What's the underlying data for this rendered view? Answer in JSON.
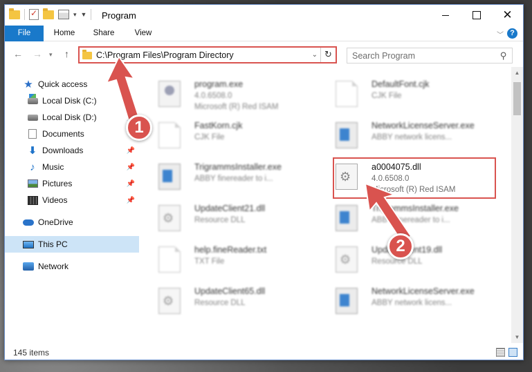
{
  "window": {
    "title": "Program"
  },
  "ribbon": {
    "tabs": [
      "File",
      "Home",
      "Share",
      "View"
    ]
  },
  "nav": {
    "address": "C:\\Program Files\\Program Directory",
    "search_placeholder": "Search Program"
  },
  "sidebar": {
    "items": [
      {
        "label": "Quick access",
        "icon": "star-icon",
        "pinned": false
      },
      {
        "label": "Local Disk (C:)",
        "icon": "drive-icon",
        "pinned": false
      },
      {
        "label": "Local Disk (D:)",
        "icon": "drive-icon",
        "pinned": true
      },
      {
        "label": "Documents",
        "icon": "document-icon",
        "pinned": false
      },
      {
        "label": "Downloads",
        "icon": "download-icon",
        "pinned": true
      },
      {
        "label": "Music",
        "icon": "music-icon",
        "pinned": true
      },
      {
        "label": "Pictures",
        "icon": "pictures-icon",
        "pinned": true
      },
      {
        "label": "Videos",
        "icon": "videos-icon",
        "pinned": true
      },
      {
        "label": "OneDrive",
        "icon": "cloud-icon",
        "pinned": false
      },
      {
        "label": "This PC",
        "icon": "computer-icon",
        "pinned": false,
        "selected": true
      },
      {
        "label": "Network",
        "icon": "network-icon",
        "pinned": false
      }
    ]
  },
  "files": [
    {
      "name": "program.exe",
      "line1": "4.0.6508.0",
      "line2": "Microsoft (R) Red ISAM",
      "icon": "exe-icon"
    },
    {
      "name": "DefaultFont.cjk",
      "line1": "CJK File",
      "line2": "",
      "icon": "file-icon"
    },
    {
      "name": "FastKorn.cjk",
      "line1": "CJK File",
      "line2": "",
      "icon": "file-icon"
    },
    {
      "name": "NetworkLicenseServer.exe",
      "line1": "ABBY network licens...",
      "line2": "",
      "icon": "app-icon"
    },
    {
      "name": "TrigrammsInstaller.exe",
      "line1": "ABBY finereader to i...",
      "line2": "",
      "icon": "app-icon"
    },
    {
      "name": "a0004075.dll",
      "line1": "4.0.6508.0",
      "line2": "Microsoft (R) Red ISAM",
      "icon": "dll-gear-icon"
    },
    {
      "name": "UpdateClient21.dll",
      "line1": "Resource DLL",
      "line2": "",
      "icon": "dll-gear-icon"
    },
    {
      "name": "TrigrammsInstaller.exe",
      "line1": "ABBY finereader to i...",
      "line2": "",
      "icon": "app-icon"
    },
    {
      "name": "help.fineReader.txt",
      "line1": "TXT File",
      "line2": "",
      "icon": "file-icon"
    },
    {
      "name": "UpdateClient19.dll",
      "line1": "Resource DLL",
      "line2": "",
      "icon": "dll-gear-icon"
    },
    {
      "name": "UpdateClient65.dll",
      "line1": "Resource DLL",
      "line2": "",
      "icon": "dll-gear-icon"
    },
    {
      "name": "NetworkLicenseServer.exe",
      "line1": "ABBY network licens...",
      "line2": "",
      "icon": "app-icon"
    }
  ],
  "status": {
    "items_count": "145 items"
  },
  "annotations": {
    "step1": "1",
    "step2": "2",
    "color": "#d9534f"
  }
}
